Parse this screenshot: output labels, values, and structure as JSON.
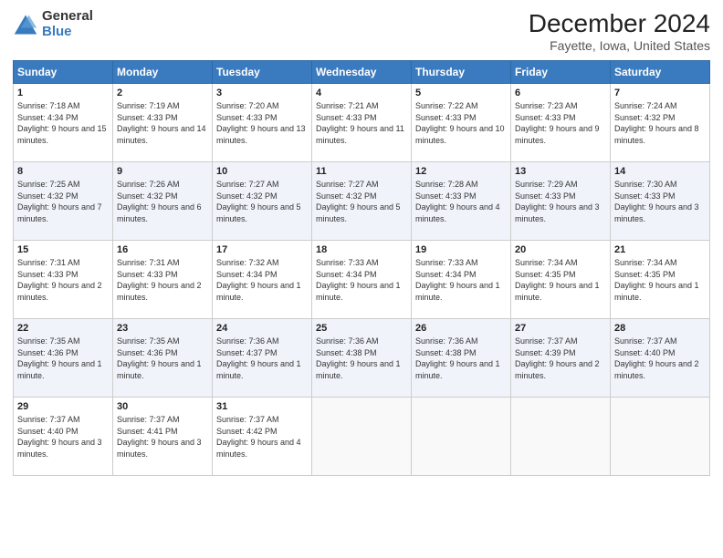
{
  "logo": {
    "general": "General",
    "blue": "Blue"
  },
  "header": {
    "title": "December 2024",
    "subtitle": "Fayette, Iowa, United States"
  },
  "weekdays": [
    "Sunday",
    "Monday",
    "Tuesday",
    "Wednesday",
    "Thursday",
    "Friday",
    "Saturday"
  ],
  "weeks": [
    [
      {
        "day": 1,
        "sunrise": "7:18 AM",
        "sunset": "4:34 PM",
        "daylight": "9 hours and 15 minutes."
      },
      {
        "day": 2,
        "sunrise": "7:19 AM",
        "sunset": "4:33 PM",
        "daylight": "9 hours and 14 minutes."
      },
      {
        "day": 3,
        "sunrise": "7:20 AM",
        "sunset": "4:33 PM",
        "daylight": "9 hours and 13 minutes."
      },
      {
        "day": 4,
        "sunrise": "7:21 AM",
        "sunset": "4:33 PM",
        "daylight": "9 hours and 11 minutes."
      },
      {
        "day": 5,
        "sunrise": "7:22 AM",
        "sunset": "4:33 PM",
        "daylight": "9 hours and 10 minutes."
      },
      {
        "day": 6,
        "sunrise": "7:23 AM",
        "sunset": "4:33 PM",
        "daylight": "9 hours and 9 minutes."
      },
      {
        "day": 7,
        "sunrise": "7:24 AM",
        "sunset": "4:32 PM",
        "daylight": "9 hours and 8 minutes."
      }
    ],
    [
      {
        "day": 8,
        "sunrise": "7:25 AM",
        "sunset": "4:32 PM",
        "daylight": "9 hours and 7 minutes."
      },
      {
        "day": 9,
        "sunrise": "7:26 AM",
        "sunset": "4:32 PM",
        "daylight": "9 hours and 6 minutes."
      },
      {
        "day": 10,
        "sunrise": "7:27 AM",
        "sunset": "4:32 PM",
        "daylight": "9 hours and 5 minutes."
      },
      {
        "day": 11,
        "sunrise": "7:27 AM",
        "sunset": "4:32 PM",
        "daylight": "9 hours and 5 minutes."
      },
      {
        "day": 12,
        "sunrise": "7:28 AM",
        "sunset": "4:33 PM",
        "daylight": "9 hours and 4 minutes."
      },
      {
        "day": 13,
        "sunrise": "7:29 AM",
        "sunset": "4:33 PM",
        "daylight": "9 hours and 3 minutes."
      },
      {
        "day": 14,
        "sunrise": "7:30 AM",
        "sunset": "4:33 PM",
        "daylight": "9 hours and 3 minutes."
      }
    ],
    [
      {
        "day": 15,
        "sunrise": "7:31 AM",
        "sunset": "4:33 PM",
        "daylight": "9 hours and 2 minutes."
      },
      {
        "day": 16,
        "sunrise": "7:31 AM",
        "sunset": "4:33 PM",
        "daylight": "9 hours and 2 minutes."
      },
      {
        "day": 17,
        "sunrise": "7:32 AM",
        "sunset": "4:34 PM",
        "daylight": "9 hours and 1 minute."
      },
      {
        "day": 18,
        "sunrise": "7:33 AM",
        "sunset": "4:34 PM",
        "daylight": "9 hours and 1 minute."
      },
      {
        "day": 19,
        "sunrise": "7:33 AM",
        "sunset": "4:34 PM",
        "daylight": "9 hours and 1 minute."
      },
      {
        "day": 20,
        "sunrise": "7:34 AM",
        "sunset": "4:35 PM",
        "daylight": "9 hours and 1 minute."
      },
      {
        "day": 21,
        "sunrise": "7:34 AM",
        "sunset": "4:35 PM",
        "daylight": "9 hours and 1 minute."
      }
    ],
    [
      {
        "day": 22,
        "sunrise": "7:35 AM",
        "sunset": "4:36 PM",
        "daylight": "9 hours and 1 minute."
      },
      {
        "day": 23,
        "sunrise": "7:35 AM",
        "sunset": "4:36 PM",
        "daylight": "9 hours and 1 minute."
      },
      {
        "day": 24,
        "sunrise": "7:36 AM",
        "sunset": "4:37 PM",
        "daylight": "9 hours and 1 minute."
      },
      {
        "day": 25,
        "sunrise": "7:36 AM",
        "sunset": "4:38 PM",
        "daylight": "9 hours and 1 minute."
      },
      {
        "day": 26,
        "sunrise": "7:36 AM",
        "sunset": "4:38 PM",
        "daylight": "9 hours and 1 minute."
      },
      {
        "day": 27,
        "sunrise": "7:37 AM",
        "sunset": "4:39 PM",
        "daylight": "9 hours and 2 minutes."
      },
      {
        "day": 28,
        "sunrise": "7:37 AM",
        "sunset": "4:40 PM",
        "daylight": "9 hours and 2 minutes."
      }
    ],
    [
      {
        "day": 29,
        "sunrise": "7:37 AM",
        "sunset": "4:40 PM",
        "daylight": "9 hours and 3 minutes."
      },
      {
        "day": 30,
        "sunrise": "7:37 AM",
        "sunset": "4:41 PM",
        "daylight": "9 hours and 3 minutes."
      },
      {
        "day": 31,
        "sunrise": "7:37 AM",
        "sunset": "4:42 PM",
        "daylight": "9 hours and 4 minutes."
      },
      null,
      null,
      null,
      null
    ]
  ]
}
